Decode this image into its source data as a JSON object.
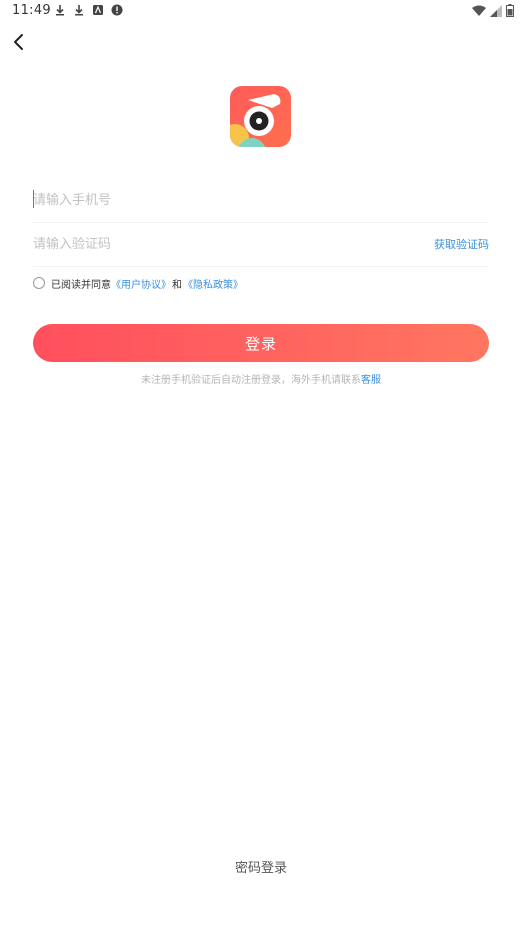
{
  "status_bar": {
    "time": "11:49"
  },
  "form": {
    "phone_placeholder": "请输入手机号",
    "code_placeholder": "请输入验证码",
    "get_code_label": "获取验证码"
  },
  "agreement": {
    "prefix": "已阅读并同意",
    "user_agreement": "《用户协议》",
    "and": "和",
    "privacy_policy": "《隐私政策》"
  },
  "login_button_label": "登录",
  "hint": {
    "text": "未注册手机验证后自动注册登录，海外手机请联系",
    "link": "客服"
  },
  "password_login_label": "密码登录",
  "colors": {
    "accent_start": "#ff4f5e",
    "accent_end": "#ff7660",
    "link": "#3a8fe0"
  }
}
